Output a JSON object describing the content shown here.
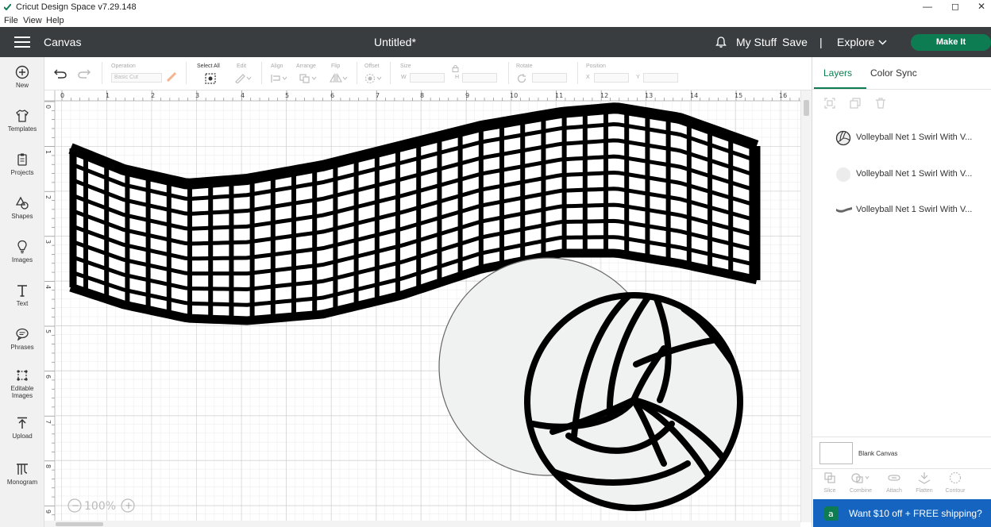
{
  "window": {
    "title": "Cricut Design Space  v7.29.148",
    "controls": [
      "—",
      "◻",
      "✕"
    ]
  },
  "menu": [
    "File",
    "View",
    "Help"
  ],
  "header": {
    "section": "Canvas",
    "doc_title": "Untitled*",
    "my_stuff": "My Stuff",
    "save": "Save",
    "separator": "|",
    "explore": "Explore",
    "make_it": "Make It"
  },
  "sidebar": {
    "items": [
      {
        "label": "New",
        "icon": "plus-circle-icon"
      },
      {
        "label": "Templates",
        "icon": "shirt-icon"
      },
      {
        "label": "Projects",
        "icon": "clipboard-icon"
      },
      {
        "label": "Shapes",
        "icon": "shapes-icon"
      },
      {
        "label": "Images",
        "icon": "lightbulb-icon"
      },
      {
        "label": "Text",
        "icon": "text-t-icon"
      },
      {
        "label": "Phrases",
        "icon": "speech-bubble-icon"
      },
      {
        "label": "Editable",
        "label2": "Images",
        "icon": "editable-images-icon"
      },
      {
        "label": "Upload",
        "icon": "upload-icon"
      },
      {
        "label": "Monogram",
        "icon": "monogram-icon"
      }
    ]
  },
  "toolbar": {
    "operation_label": "Operation",
    "operation_value": "Basic Cut",
    "select_all": "Select All",
    "edit": "Edit",
    "align": "Align",
    "arrange": "Arrange",
    "flip": "Flip",
    "offset": "Offset",
    "size": "Size",
    "w": "W",
    "h": "H",
    "rotate": "Rotate",
    "position": "Position",
    "x": "X",
    "y": "Y"
  },
  "canvas": {
    "ruler_top": [
      "0",
      "1",
      "2",
      "3",
      "4",
      "5",
      "6",
      "7",
      "8",
      "9",
      "10",
      "11",
      "12",
      "13",
      "14",
      "15",
      "16"
    ],
    "ruler_left": [
      "0",
      "1",
      "2",
      "3",
      "4",
      "5",
      "6",
      "7",
      "8",
      "9"
    ],
    "zoom": "100%",
    "zoom_out": "−",
    "zoom_in": "+"
  },
  "layers_panel": {
    "tab_layers": "Layers",
    "tab_color_sync": "Color Sync",
    "layers": [
      {
        "name": "Volleyball Net 1 Swirl With V...",
        "icon": "volleyball-icon"
      },
      {
        "name": "Volleyball Net 1 Swirl With V...",
        "icon": "circle-icon"
      },
      {
        "name": "Volleyball Net 1 Swirl With V...",
        "icon": "net-swirl-icon"
      }
    ],
    "blank_canvas": "Blank Canvas",
    "bottom_tools": [
      "Slice",
      "Combine",
      "Attach",
      "Flatten",
      "Contour"
    ]
  },
  "promo": {
    "text": "Want $10 off + FREE shipping?",
    "icon": "amazon-icon",
    "color": "#1565c0"
  },
  "colors": {
    "brand_green": "#0e7c53",
    "header_bg": "#3a3d40",
    "ball_fill": "#f0f1f1"
  }
}
